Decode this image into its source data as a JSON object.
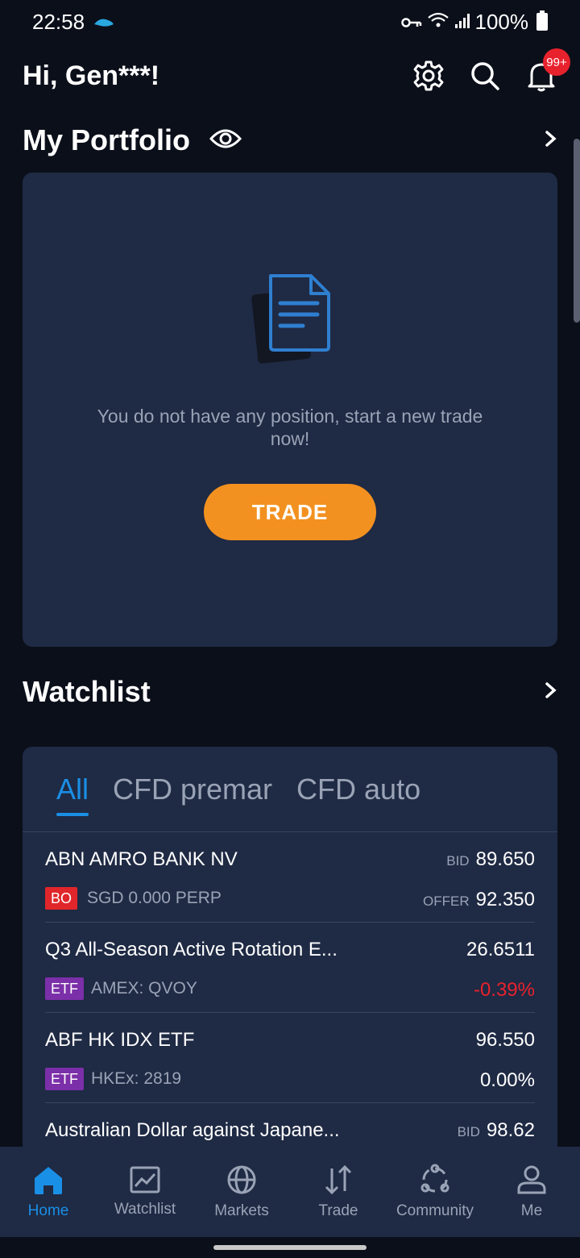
{
  "status_bar": {
    "time": "22:58",
    "battery": "100%"
  },
  "header": {
    "greeting": "Hi, Gen***!",
    "notification_count": "99+"
  },
  "portfolio": {
    "title": "My Portfolio",
    "empty_message": "You do not have any position, start a new trade now!",
    "trade_button": "TRADE"
  },
  "watchlist": {
    "title": "Watchlist",
    "tabs": [
      "All",
      "CFD premar",
      "CFD auto"
    ],
    "rows": [
      {
        "name": "ABN AMRO BANK NV",
        "tag": "BO",
        "tag_color": "#e0262a",
        "sub": "SGD 0.000 PERP",
        "label1": "BID",
        "val1": "89.650",
        "label2": "OFFER",
        "val2": "92.350",
        "val2_color": "#ffffff"
      },
      {
        "name": "Q3 All-Season Active Rotation E...",
        "tag": "ETF",
        "tag_color": "#7b2fa8",
        "sub": "AMEX: QVOY",
        "label1": "",
        "val1": "26.6511",
        "label2": "",
        "val2": "-0.39%",
        "val2_color": "#e8222d"
      },
      {
        "name": "ABF HK IDX ETF",
        "tag": "ETF",
        "tag_color": "#7b2fa8",
        "sub": "HKEx: 2819",
        "label1": "",
        "val1": "96.550",
        "label2": "",
        "val2": "0.00%",
        "val2_color": "#ffffff"
      },
      {
        "name": "Australian Dollar against Japane...",
        "tag": "",
        "tag_color": "",
        "sub": "",
        "label1": "BID",
        "val1": "98.62",
        "label2": "",
        "val2": "",
        "val2_color": "#ffffff"
      }
    ]
  },
  "nav": {
    "items": [
      {
        "label": "Home",
        "icon": "home-icon"
      },
      {
        "label": "Watchlist",
        "icon": "chart-icon"
      },
      {
        "label": "Markets",
        "icon": "globe-icon"
      },
      {
        "label": "Trade",
        "icon": "arrows-icon"
      },
      {
        "label": "Community",
        "icon": "community-icon"
      },
      {
        "label": "Me",
        "icon": "user-icon"
      }
    ]
  },
  "colors": {
    "accent": "#1a8fe6",
    "trade_orange": "#f39120",
    "card_bg": "#1f2a44",
    "page_bg": "#0b0f1a"
  }
}
